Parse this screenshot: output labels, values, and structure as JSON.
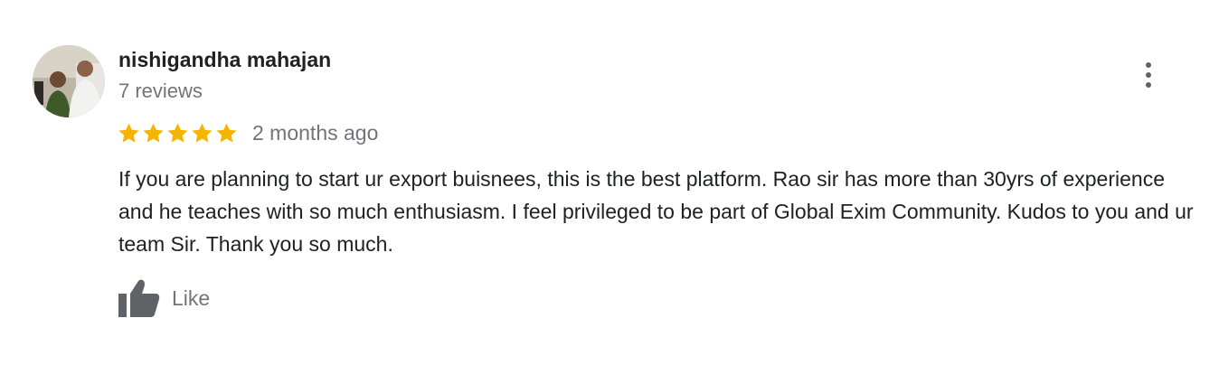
{
  "review": {
    "author_name": "nishigandha mahajan",
    "review_count": "7 reviews",
    "rating": 5,
    "rating_max": 5,
    "date": "2 months ago",
    "text": "If you are planning to start ur export buisnees, this is the best platform. Rao sir has more than 30yrs of experience and he teaches with so much enthusiasm. I feel privileged to be part of Global Exim Community. Kudos to you and ur team Sir. Thank you so much.",
    "like_label": "Like"
  },
  "colors": {
    "star": "#f4b400",
    "name": "#202124",
    "secondary_text": "#70757a",
    "like_icon": "#5f6368"
  },
  "icons": {
    "more": "more-vert-icon",
    "like": "thumb-up-icon",
    "star": "star-icon"
  }
}
